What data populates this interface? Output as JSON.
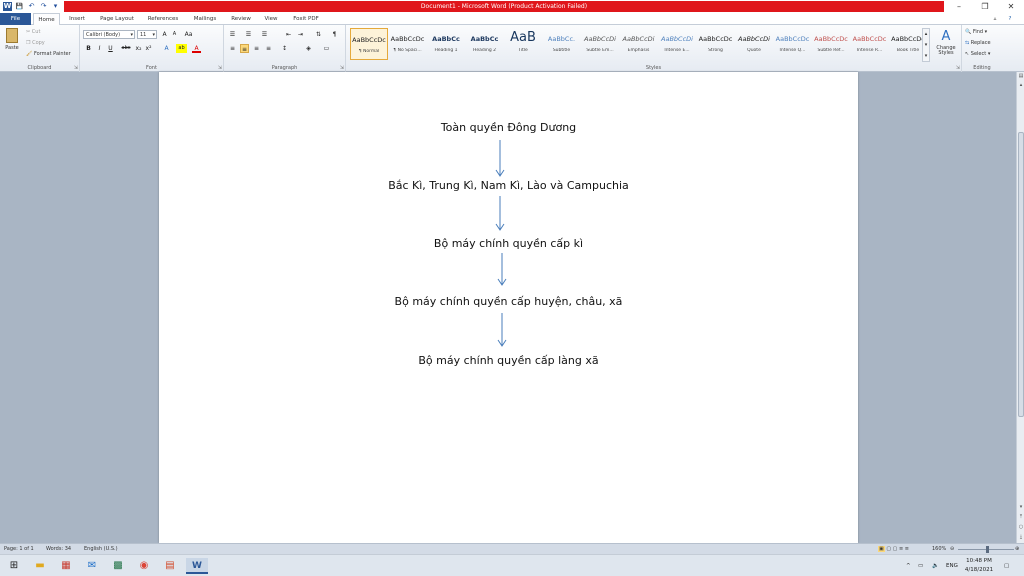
{
  "window": {
    "title": "Document1 - Microsoft Word (Product Activation Failed)",
    "minimize": "–",
    "restore": "❐",
    "close": "✕"
  },
  "qat": {
    "save": "💾",
    "undo": "↶",
    "redo": "↷",
    "customize": "▾"
  },
  "tabs": [
    "File",
    "Home",
    "Insert",
    "Page Layout",
    "References",
    "Mailings",
    "Review",
    "View",
    "Foxit PDF"
  ],
  "ribbon": {
    "clipboard": {
      "paste": "Paste",
      "cut": "Cut",
      "copy": "Copy",
      "format_painter": "Format Painter",
      "label": "Clipboard"
    },
    "font": {
      "font_name": "Calibri (Body)",
      "font_size": "11",
      "label": "Font",
      "grow": "A",
      "shrink": "A",
      "clear": "Aa",
      "bold": "B",
      "italic": "I",
      "underline": "U",
      "strike": "abc",
      "sub": "x₂",
      "sup": "x²",
      "effects": "A",
      "highlight": "ab",
      "color": "A"
    },
    "paragraph": {
      "label": "Paragraph"
    },
    "styles": {
      "label": "Styles",
      "items": [
        {
          "sample": "AaBbCcDc",
          "name": "¶ Normal"
        },
        {
          "sample": "AaBbCcDc",
          "name": "¶ No Spaci..."
        },
        {
          "sample": "AaBbCc",
          "name": "Heading 1"
        },
        {
          "sample": "AaBbCc",
          "name": "Heading 2"
        },
        {
          "sample": "AaB",
          "name": "Title"
        },
        {
          "sample": "AaBbCc.",
          "name": "Subtitle"
        },
        {
          "sample": "AaBbCcDi",
          "name": "Subtle Em..."
        },
        {
          "sample": "AaBbCcDi",
          "name": "Emphasis"
        },
        {
          "sample": "AaBbCcDi",
          "name": "Intense E..."
        },
        {
          "sample": "AaBbCcDc",
          "name": "Strong"
        },
        {
          "sample": "AaBbCcDi",
          "name": "Quote"
        },
        {
          "sample": "AaBbCcDc",
          "name": "Intense Q..."
        },
        {
          "sample": "AaBbCcDc",
          "name": "Subtle Ref..."
        },
        {
          "sample": "AaBbCcDc",
          "name": "Intense R..."
        },
        {
          "sample": "AaBbCcDc",
          "name": "Book Title"
        }
      ],
      "change_styles": "Change Styles"
    },
    "editing": {
      "find": "Find",
      "replace": "Replace",
      "select": "Select",
      "label": "Editing"
    }
  },
  "document": {
    "lines": [
      "Toàn quyền Đông Dương",
      "Bắc Kì, Trung Kì, Nam Kì, Lào và Campuchia",
      "Bộ máy chính quyền cấp kì",
      "Bộ máy chính quyền cấp huyện, châu, xã",
      "Bộ máy chính quyền cấp làng xã"
    ]
  },
  "statusbar": {
    "page": "Page: 1 of 1",
    "words": "Words: 34",
    "language": "English (U.S.)",
    "zoom": "160%"
  },
  "taskbar": {
    "time": "10:48 PM",
    "date": "4/18/2021",
    "lang": "ENG",
    "tray_up": "^"
  },
  "colors": {
    "title_red": "#e0161b",
    "file_tab": "#2b5797",
    "arrow": "#4a7ebb"
  }
}
